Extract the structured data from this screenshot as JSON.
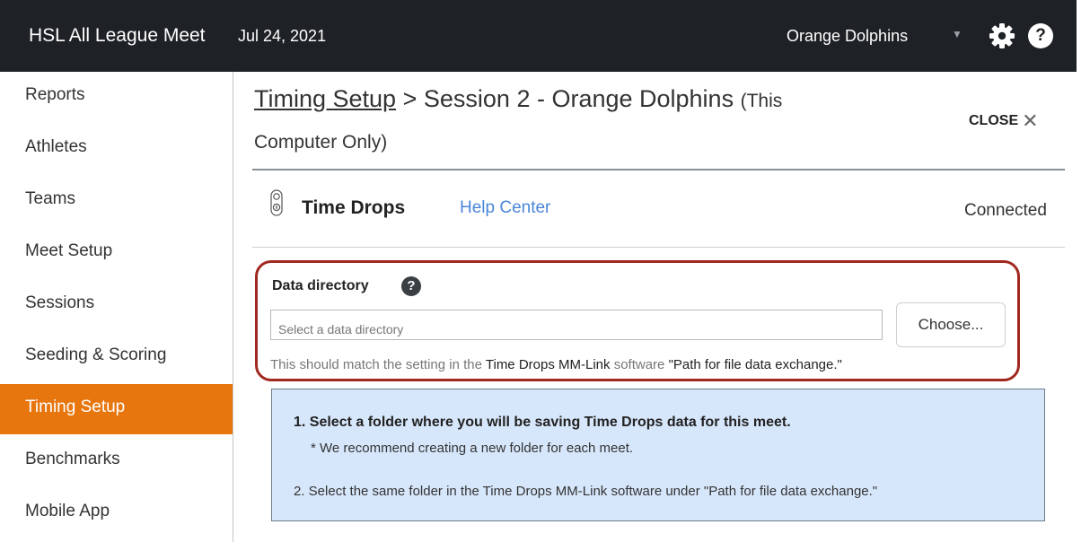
{
  "topbar": {
    "meet_name": "HSL All League Meet",
    "meet_date": "Jul 24, 2021",
    "team": "Orange Dolphins",
    "caret": "▼",
    "help_glyph": "?",
    "background_color": "#1e2226",
    "icons": [
      "gear-icon",
      "help-icon",
      "caret-down-icon"
    ]
  },
  "sidebar": {
    "items": [
      {
        "label": "Reports",
        "active": false
      },
      {
        "label": "Athletes",
        "active": false
      },
      {
        "label": "Teams",
        "active": false
      },
      {
        "label": "Meet Setup",
        "active": false
      },
      {
        "label": "Sessions",
        "active": false
      },
      {
        "label": "Seeding & Scoring",
        "active": false
      },
      {
        "label": "Timing Setup",
        "active": true
      },
      {
        "label": "Benchmarks",
        "active": false
      },
      {
        "label": "Mobile App",
        "active": false
      }
    ],
    "active_color": "#e8760f"
  },
  "header": {
    "breadcrumb_link": "Timing Setup",
    "separator": ">",
    "session_title": "Session 2 - Orange Dolphins",
    "scope_open": "(This",
    "scope_close": "Computer Only)",
    "close_label": "CLOSE",
    "close_glyph": "✕"
  },
  "device": {
    "icon": "time-drops-device-icon",
    "name": "Time Drops",
    "help_link": "Help Center",
    "status": "Connected",
    "link_color": "#4a86d8"
  },
  "data_directory": {
    "label": "Data directory",
    "help_glyph": "?",
    "value": "",
    "placeholder": "Select a data directory",
    "choose_label": "Choose...",
    "hint_prefix": "This should match the setting in the",
    "hint_software": "Time Drops MM-Link",
    "hint_middle": "software",
    "hint_setting": "\"Path for file data exchange.\"",
    "highlight_color": "#a0281f"
  },
  "instructions": {
    "step1": "1. Select a folder where you will be saving Time Drops data for this meet.",
    "note": "* We recommend creating a new folder for each meet.",
    "step2": "2. Select the same folder in the Time Drops MM-Link software under \"Path for file data exchange.\"",
    "background_color": "#d7e7fb"
  }
}
